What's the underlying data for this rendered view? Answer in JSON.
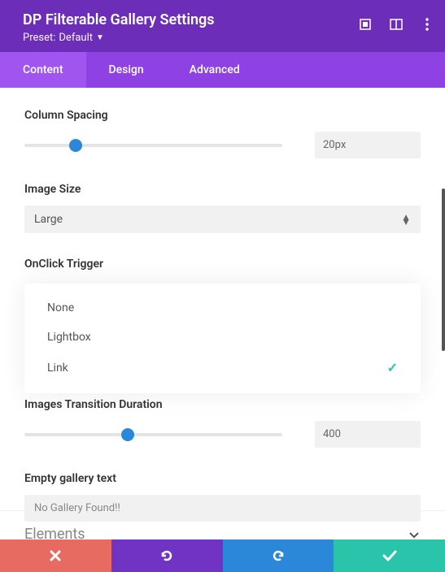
{
  "header": {
    "title": "DP Filterable Gallery Settings",
    "preset_label": "Preset:",
    "preset_value": "Default"
  },
  "tabs": [
    "Content",
    "Design",
    "Advanced"
  ],
  "active_tab": 0,
  "fields": {
    "column_spacing": {
      "label": "Column Spacing",
      "value": "20px",
      "thumb_pct": 20
    },
    "image_size": {
      "label": "Image Size",
      "value": "Large"
    },
    "onclick_trigger": {
      "label": "OnClick Trigger",
      "options": [
        "None",
        "Lightbox",
        "Link"
      ],
      "selected": "Link"
    },
    "transition_duration": {
      "label": "Images Transition Duration",
      "value": "400",
      "thumb_pct": 40
    },
    "empty_text": {
      "label": "Empty gallery text",
      "value": "No Gallery Found!!"
    }
  },
  "elements_section": "Elements"
}
